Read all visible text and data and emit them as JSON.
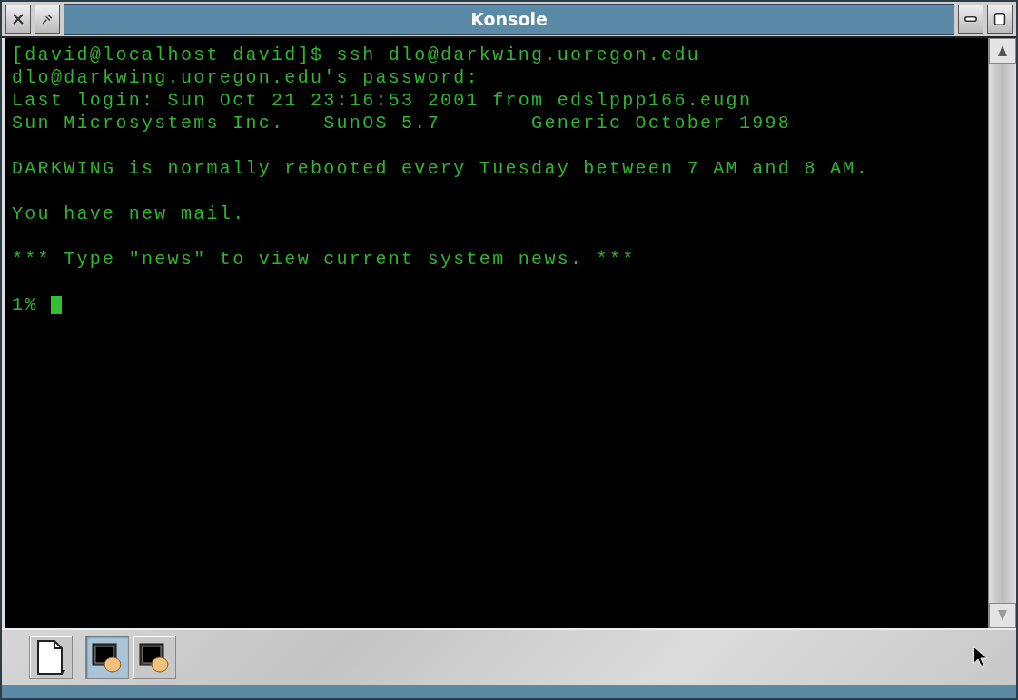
{
  "window": {
    "title": "Konsole"
  },
  "terminal": {
    "blocks": [
      [
        "[david@localhost david]$ ssh dlo@darkwing.uoregon.edu",
        "dlo@darkwing.uoregon.edu's password:",
        "Last login: Sun Oct 21 23:16:53 2001 from edslppp166.eugn",
        "Sun Microsystems Inc.   SunOS 5.7       Generic October 1998"
      ],
      [
        "DARKWING is normally rebooted every Tuesday between 7 AM and 8 AM."
      ],
      [
        "You have new mail."
      ],
      [
        "*** Type \"news\" to view current system news. ***"
      ]
    ],
    "prompt": "1%"
  },
  "sessions": [
    {
      "selected": true
    },
    {
      "selected": false
    }
  ]
}
